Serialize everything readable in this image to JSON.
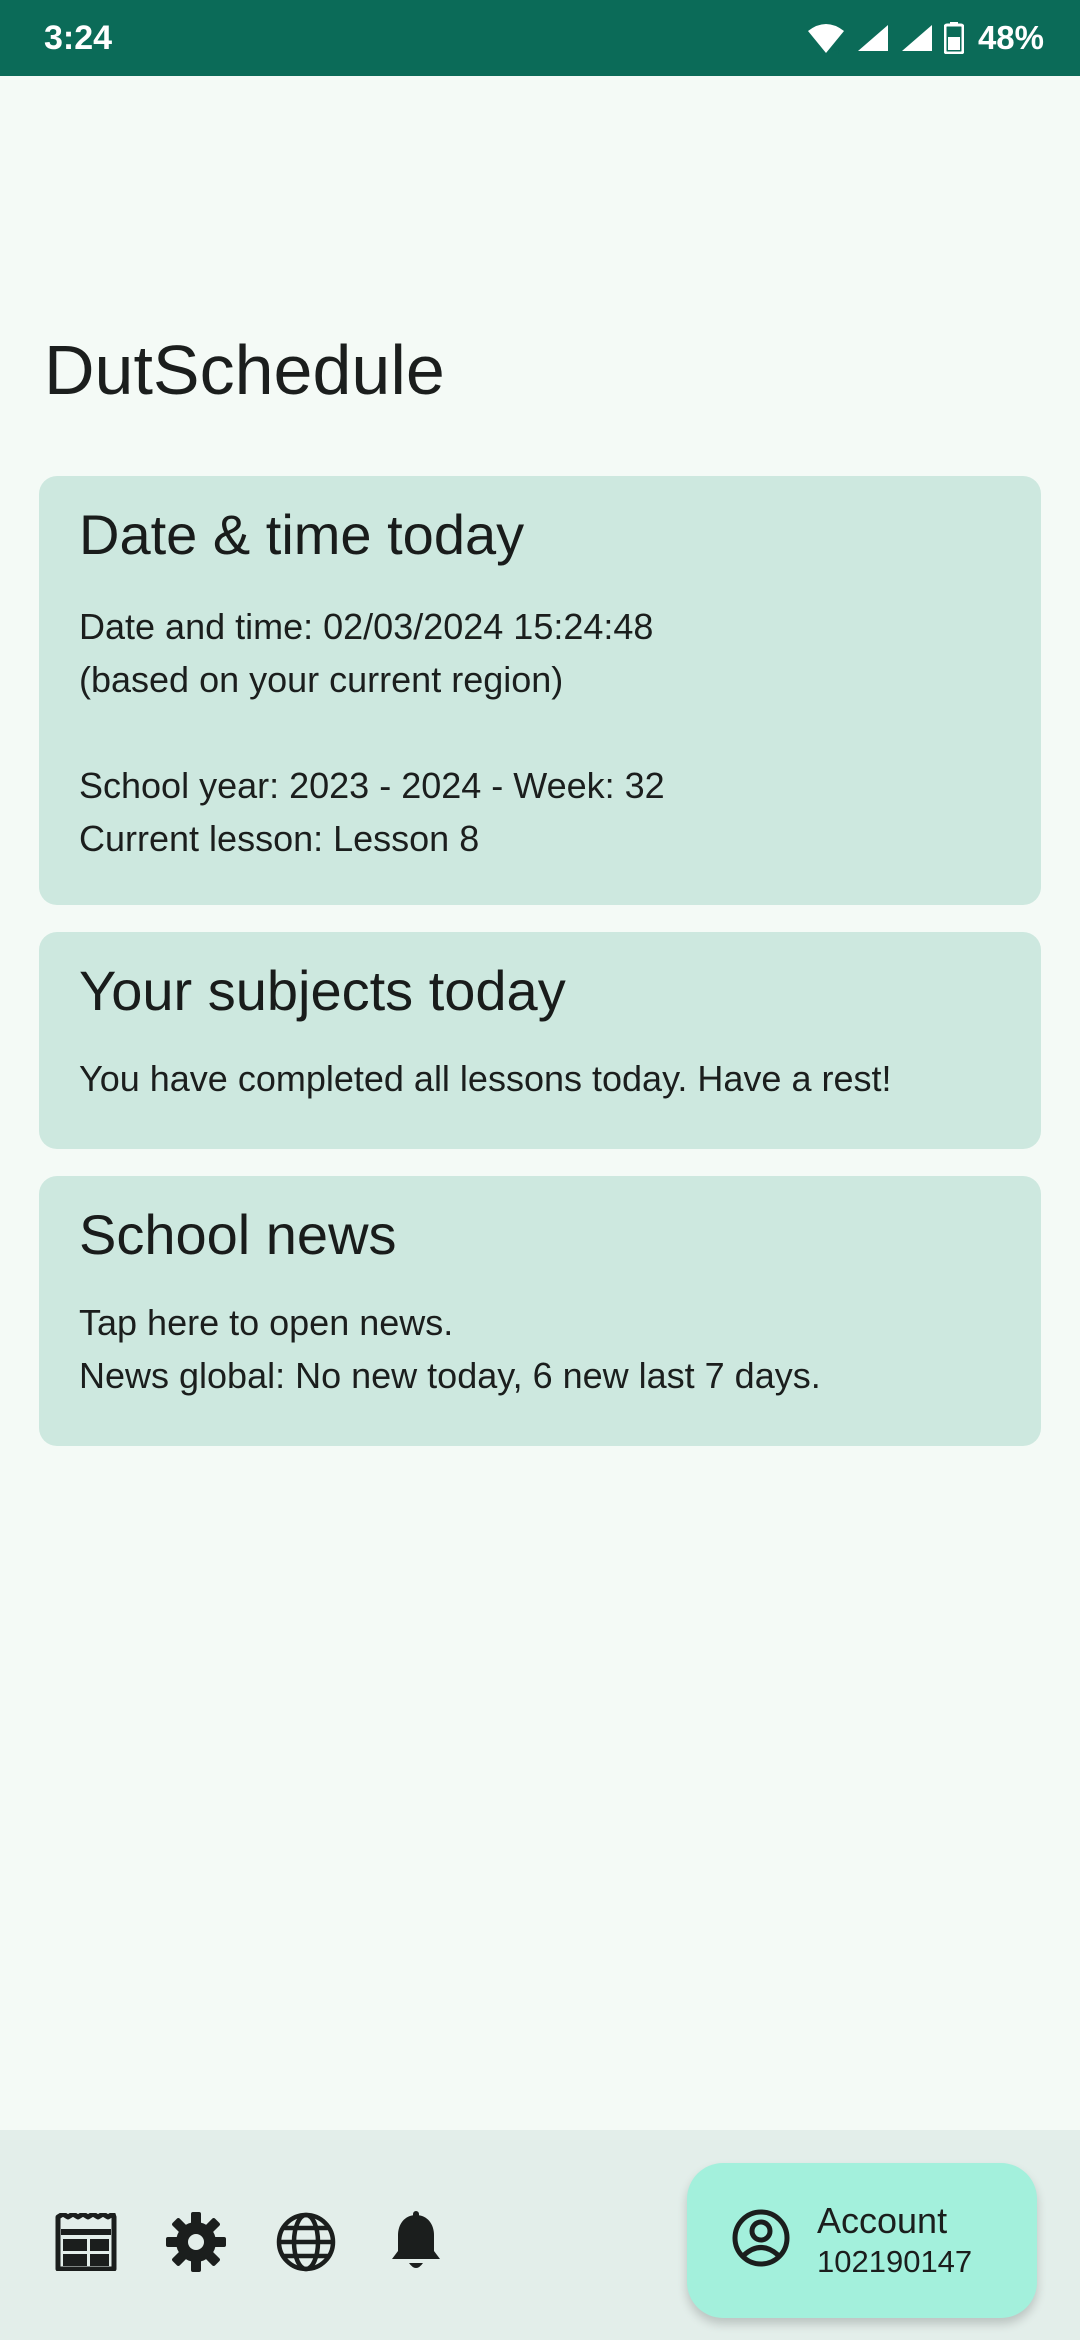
{
  "status_bar": {
    "time": "3:24",
    "battery": "48%",
    "icons": [
      "wifi-icon",
      "signal-icon",
      "signal-icon",
      "battery-icon"
    ],
    "wifi_badge": "4"
  },
  "app": {
    "title": "DutSchedule"
  },
  "cards": {
    "datetime": {
      "title": "Date & time today",
      "line1": "Date and time: 02/03/2024 15:24:48",
      "line2": "(based on your current region)",
      "line3": "School year: 2023 - 2024 - Week: 32",
      "line4": "Current lesson: Lesson 8"
    },
    "subjects": {
      "title": "Your subjects today",
      "line1": "You have completed all lessons today. Have a rest!"
    },
    "news": {
      "title": "School news",
      "line1": "Tap here to open news.",
      "line2": "News global: No new today, 6 new last 7 days."
    }
  },
  "bottom_bar": {
    "icons": [
      "schedule-icon",
      "settings-icon",
      "globe-icon",
      "bell-icon"
    ],
    "account": {
      "label": "Account",
      "id": "102190147",
      "icon": "account-circle-icon"
    }
  },
  "colors": {
    "status_bar": "#0b6b58",
    "background": "#f4faf6",
    "card": "#cde8df",
    "bottom_bar": "#e3eeea",
    "account_button": "#a3f0dc"
  }
}
